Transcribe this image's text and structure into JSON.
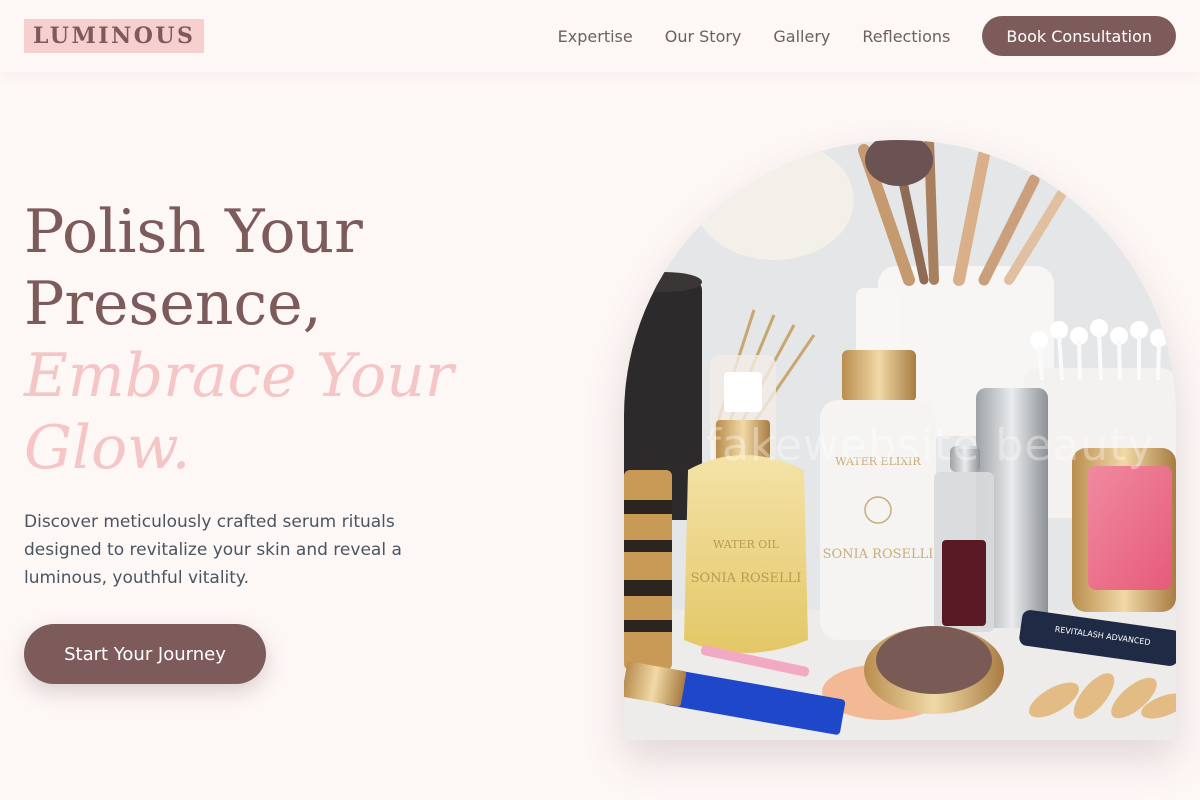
{
  "brand": {
    "logo_text": "LUMINOUS"
  },
  "nav": {
    "links": [
      "Expertise",
      "Our Story",
      "Gallery",
      "Reflections"
    ],
    "cta_label": "Book Consultation"
  },
  "hero": {
    "title_line1": "Polish Your",
    "title_line2": "Presence,",
    "title_accent1": "Embrace Your",
    "title_accent2": "Glow.",
    "description": "Discover meticulously crafted serum rituals designed to revitalize your skin and reveal a luminous, youthful vitality.",
    "cta_label": "Start Your Journey"
  },
  "image": {
    "watermark": "fakewebsite beauty",
    "bottle_left_label": "WATER OIL",
    "bottle_left_brand": "SONIA ROSELLI",
    "bottle_center_label": "WATER ELIXIR",
    "bottle_center_brand": "SONIA ROSELLI",
    "mascara_label": "REVITALASH ADVANCED"
  },
  "colors": {
    "primary": "#7d5b5b",
    "accent_pink": "#f4c6c6",
    "logo_bg": "#f6cfcf",
    "page_bg": "#fdf7f6",
    "body_text": "#4a5560"
  }
}
